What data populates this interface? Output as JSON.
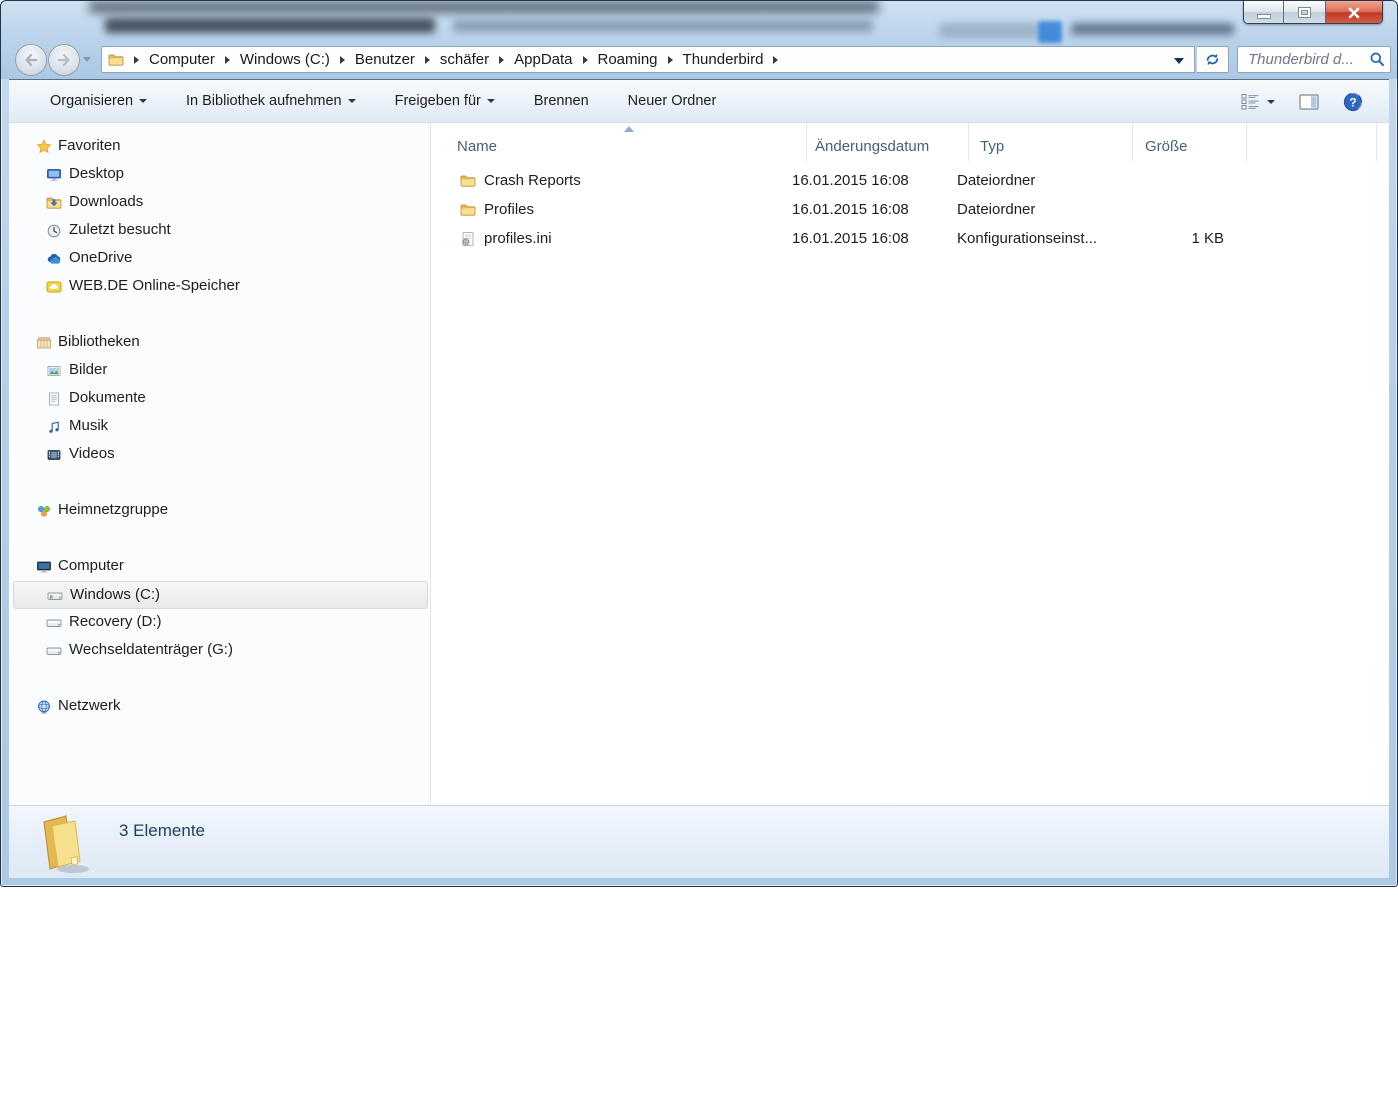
{
  "titlebar": {
    "controls": [
      "minimize",
      "maximize",
      "close"
    ]
  },
  "navbar": {
    "breadcrumb": [
      "Computer",
      "Windows (C:)",
      "Benutzer",
      "schäfer",
      "AppData",
      "Roaming",
      "Thunderbird"
    ],
    "search_placeholder": "Thunderbird d..."
  },
  "toolbar": {
    "items": [
      {
        "label": "Organisieren",
        "dropdown": true
      },
      {
        "label": "In Bibliothek aufnehmen",
        "dropdown": true
      },
      {
        "label": "Freigeben für",
        "dropdown": true
      },
      {
        "label": "Brennen",
        "dropdown": false
      },
      {
        "label": "Neuer Ordner",
        "dropdown": false
      }
    ],
    "right_items": [
      {
        "icon": "change-view-icon",
        "dropdown": true
      },
      {
        "icon": "preview-pane-icon",
        "dropdown": false
      },
      {
        "icon": "help-icon",
        "dropdown": false
      }
    ]
  },
  "sidebar": {
    "sections": [
      {
        "label": "Favoriten",
        "icon": "star-icon",
        "children": [
          {
            "label": "Desktop",
            "icon": "desktop-icon"
          },
          {
            "label": "Downloads",
            "icon": "downloads-icon"
          },
          {
            "label": "Zuletzt besucht",
            "icon": "recent-places-icon"
          },
          {
            "label": "OneDrive",
            "icon": "onedrive-icon"
          },
          {
            "label": "WEB.DE Online-Speicher",
            "icon": "webde-cloud-icon"
          }
        ]
      },
      {
        "label": "Bibliotheken",
        "icon": "libraries-icon",
        "children": [
          {
            "label": "Bilder",
            "icon": "pictures-icon"
          },
          {
            "label": "Dokumente",
            "icon": "documents-icon"
          },
          {
            "label": "Musik",
            "icon": "music-icon"
          },
          {
            "label": "Videos",
            "icon": "videos-icon"
          }
        ]
      },
      {
        "label": "Heimnetzgruppe",
        "icon": "homegroup-icon",
        "children": []
      },
      {
        "label": "Computer",
        "icon": "computer-icon",
        "children": [
          {
            "label": "Windows (C:)",
            "icon": "drive-windows-icon",
            "selected": true
          },
          {
            "label": "Recovery (D:)",
            "icon": "drive-icon"
          },
          {
            "label": "Wechseldatenträger (G:)",
            "icon": "drive-removable-icon"
          }
        ]
      },
      {
        "label": "Netzwerk",
        "icon": "network-icon",
        "children": []
      }
    ]
  },
  "filelist": {
    "columns": [
      "Name",
      "Änderungsdatum",
      "Typ",
      "Größe"
    ],
    "sort": {
      "column": "Name",
      "direction": "asc"
    },
    "rows": [
      {
        "name": "Crash Reports",
        "icon": "folder-icon",
        "modified": "16.01.2015 16:08",
        "type": "Dateiordner",
        "size": ""
      },
      {
        "name": "Profiles",
        "icon": "folder-icon",
        "modified": "16.01.2015 16:08",
        "type": "Dateiordner",
        "size": ""
      },
      {
        "name": "profiles.ini",
        "icon": "ini-file-icon",
        "modified": "16.01.2015 16:08",
        "type": "Konfigurationseinst...",
        "size": "1 KB"
      }
    ]
  },
  "statusbar": {
    "text": "3 Elemente"
  },
  "colors": {
    "titlebar_glass": "#b9d1e9",
    "close_button_red": "#c0392b",
    "folder_yellow": "#f5d76b",
    "accent_blue": "#2b6cb8",
    "header_text": "#44617e",
    "status_text": "#1e3f63",
    "selection_highlight": "#ececec"
  }
}
